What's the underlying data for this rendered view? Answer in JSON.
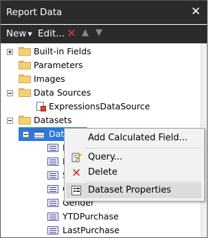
{
  "window": {
    "title": "Report Data"
  },
  "toolbar": {
    "new_label": "New",
    "edit_label": "Edit..."
  },
  "tree": {
    "built_in_fields": "Built-in Fields",
    "parameters": "Parameters",
    "images": "Images",
    "data_sources": "Data Sources",
    "expressions_data_source": "ExpressionsDataSource",
    "datasets": "Datasets",
    "dataset1": "DataSet1",
    "fields": [
      "F",
      "L",
      "S",
      "C",
      "Gender",
      "YTDPurchase",
      "LastPurchase"
    ]
  },
  "context_menu": {
    "items": [
      {
        "label": "Add Calculated Field..."
      },
      {
        "label": "Query..."
      },
      {
        "label": "Delete"
      },
      {
        "label": "Dataset Properties"
      }
    ]
  },
  "colors": {
    "titlebar": "#2b2b2b",
    "selection": "#2f79d6",
    "delete_red": "#d52b22",
    "folder": "#f1d27a"
  }
}
